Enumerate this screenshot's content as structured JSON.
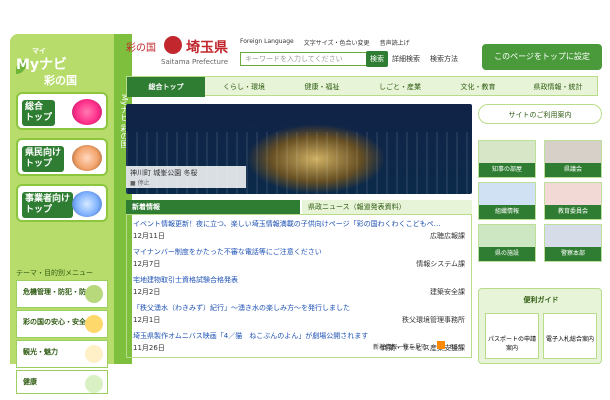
{
  "left": {
    "myn_small": "マイ",
    "myn_title": "Myナビ",
    "myn_sub": "彩の国",
    "vertical_text": "Myナビ 彩の国",
    "cards": [
      {
        "label": "総合\nトップ"
      },
      {
        "label": "県民向け\nトップ"
      },
      {
        "label": "事業者向け\nトップ"
      }
    ],
    "section_title": "テーマ・目的別メニュー",
    "boxes": [
      {
        "label": "危機管理・防犯・防災等"
      },
      {
        "label": "彩の国の安心・安全"
      },
      {
        "label": "観光・魅力"
      },
      {
        "label": "健康"
      }
    ]
  },
  "header": {
    "logo_kana": "彩の国",
    "logo_kanji": "埼玉県",
    "logo_eng": "Saitama Prefecture",
    "top_links": [
      "Foreign Language",
      "文字サイズ・色合い変更",
      "音声読上げ"
    ],
    "search_placeholder": "キーワードを入力してください",
    "search_button": "検索",
    "detail_link": "詳細検索",
    "method_link": "検索方法",
    "set_top_button": "このページをトップに設定"
  },
  "nav": {
    "items": [
      "総合トップ",
      "くらし・環境",
      "健康・福祉",
      "しごと・産業",
      "文化・教育",
      "県政情報・統計"
    ]
  },
  "hero": {
    "caption": "神川町 城峯公園 冬桜",
    "stop": "停止"
  },
  "news": {
    "tab_active": "新着情報",
    "tab_other": "県政ニュース（報道発表資料）",
    "items": [
      {
        "title": "イベント情報更新！夜に立つ、楽しい埼玉情報満載の子供向けページ「彩の国わくわくこどもページ」をご覧ください",
        "date": "12月11日",
        "dept": "広聴広報課"
      },
      {
        "title": "マイナンバー制度をかたった不審な電話等にご注意ください",
        "date": "12月7日",
        "dept": "情報システム課"
      },
      {
        "title": "宅地建物取引士資格試験合格発表",
        "date": "12月2日",
        "dept": "建築安全課"
      },
      {
        "title": "「秩父湧水（わきみず）紀行」～湧き水の楽しみ方～を発行しました",
        "date": "12月1日",
        "dept": "秩父環境管理事務所"
      },
      {
        "title": "埼玉県製作オムニバス映画「4／猫　ねこぶんのよん」が劇場公開されます",
        "date": "11月26日",
        "dept": "商業・サービス産業支援課"
      }
    ],
    "footer_list": "新着情報一覧を見る",
    "rss": "RSS"
  },
  "right": {
    "site_guide": "サイトのご利用案内",
    "tiles": [
      "知事の部屋",
      "県議会",
      "組織情報",
      "教育委員会",
      "県の施設",
      "警察本部"
    ],
    "guide_title": "便利ガイド",
    "guide_buttons": [
      "パスポートの申請案内",
      "電子入札総合案内"
    ]
  }
}
